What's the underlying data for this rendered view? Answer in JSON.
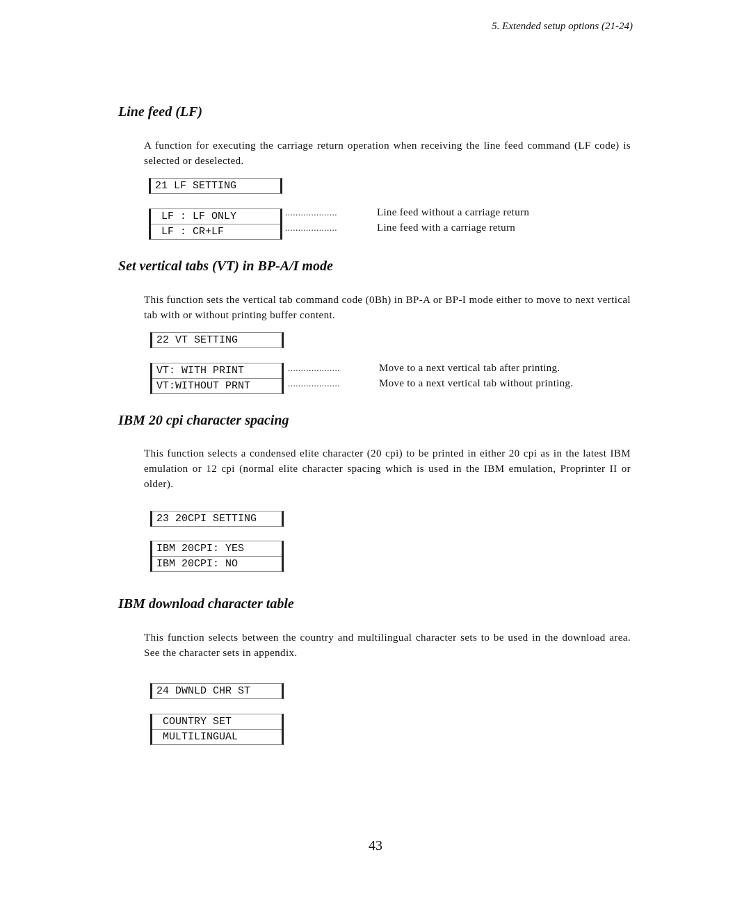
{
  "header": "5.  Extended setup options (21-24)",
  "sections": [
    {
      "title": "Line feed (LF)",
      "text": "A function for executing the carriage return operation when receiving the line feed command (LF code) is selected or deselected.",
      "setting": "21 LF SETTING",
      "options": [
        " LF : LF ONLY",
        " LF : CR+LF"
      ],
      "descriptions": [
        "Line feed without a carriage return",
        "Line feed with a carriage return"
      ]
    },
    {
      "title": "Set vertical tabs  (VT) in BP-A/I mode",
      "text": "This function sets the vertical tab command code (0Bh) in BP-A or BP-I mode either to move to next vertical tab with or without printing buffer content.",
      "setting": "22 VT SETTING",
      "options": [
        "VT: WITH PRINT",
        "VT:WITHOUT PRNT"
      ],
      "descriptions": [
        "Move to a next vertical tab after printing.",
        "Move to a next vertical tab without printing."
      ]
    },
    {
      "title": "IBM 20 cpi character spacing",
      "text": "This function selects a condensed elite character (20 cpi) to be printed in either 20 cpi as in the latest IBM emulation or 12 cpi (normal elite character spacing which is used in the IBM emulation, Proprinter II or older).",
      "setting": "23 20CPI SETTING",
      "options": [
        "IBM 20CPI: YES",
        "IBM 20CPI: NO"
      ]
    },
    {
      "title": "IBM download character table",
      "text": "This function selects between the country and multilingual character sets to be used in the download area.  See the character sets in appendix.",
      "setting": "24 DWNLD CHR ST",
      "options": [
        " COUNTRY SET",
        " MULTILINGUAL"
      ]
    }
  ],
  "leader": "....................",
  "page_number": "43"
}
